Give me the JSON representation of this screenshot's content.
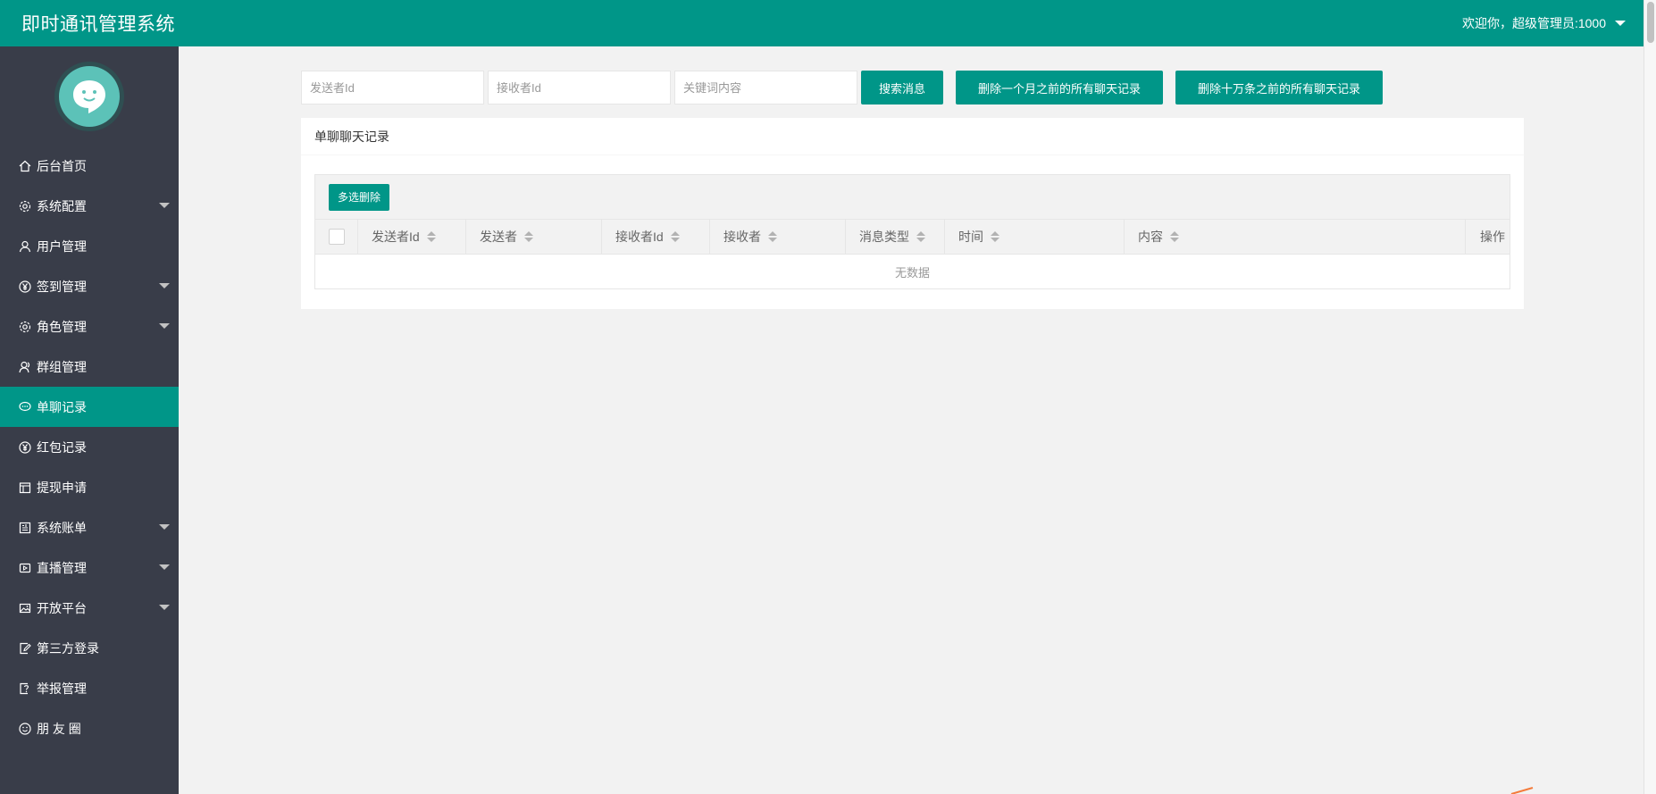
{
  "header": {
    "title": "即时通讯管理系统",
    "user": "欢迎你，超级管理员:1000"
  },
  "sidebar": {
    "items": [
      {
        "label": "后台首页",
        "icon": "home-icon",
        "expandable": false,
        "active": false
      },
      {
        "label": "系统配置",
        "icon": "gear-icon",
        "expandable": true,
        "active": false
      },
      {
        "label": "用户管理",
        "icon": "user-icon",
        "expandable": false,
        "active": false
      },
      {
        "label": "签到管理",
        "icon": "yen-icon",
        "expandable": true,
        "active": false
      },
      {
        "label": "角色管理",
        "icon": "gear-icon",
        "expandable": true,
        "active": false
      },
      {
        "label": "群组管理",
        "icon": "group-icon",
        "expandable": false,
        "active": false
      },
      {
        "label": "单聊记录",
        "icon": "chat-icon",
        "expandable": false,
        "active": true
      },
      {
        "label": "红包记录",
        "icon": "yen-icon",
        "expandable": false,
        "active": false
      },
      {
        "label": "提现申请",
        "icon": "calendar-icon",
        "expandable": false,
        "active": false
      },
      {
        "label": "系统账单",
        "icon": "bill-icon",
        "expandable": true,
        "active": false
      },
      {
        "label": "直播管理",
        "icon": "video-icon",
        "expandable": true,
        "active": false
      },
      {
        "label": "开放平台",
        "icon": "image-icon",
        "expandable": true,
        "active": false
      },
      {
        "label": "第三方登录",
        "icon": "edit-icon",
        "expandable": false,
        "active": false
      },
      {
        "label": "举报管理",
        "icon": "help-icon",
        "expandable": false,
        "active": false
      },
      {
        "label": "朋 友 圈",
        "icon": "smile-icon",
        "expandable": false,
        "active": false
      }
    ]
  },
  "search": {
    "sender_placeholder": "发送者Id",
    "receiver_placeholder": "接收者Id",
    "keyword_placeholder": "关键词内容",
    "search_button": "搜索消息",
    "delete_month_button": "删除一个月之前的所有聊天记录",
    "delete_100k_button": "删除十万条之前的所有聊天记录"
  },
  "card": {
    "title": "单聊聊天记录",
    "batch_delete": "多选删除",
    "columns": [
      "发送者Id",
      "发送者",
      "接收者Id",
      "接收者",
      "消息类型",
      "时间",
      "内容",
      "操作"
    ],
    "empty_text": "无数据"
  },
  "colors": {
    "brand": "#009688",
    "sidebar_bg": "#393d49",
    "page_bg": "#f2f2f2"
  }
}
